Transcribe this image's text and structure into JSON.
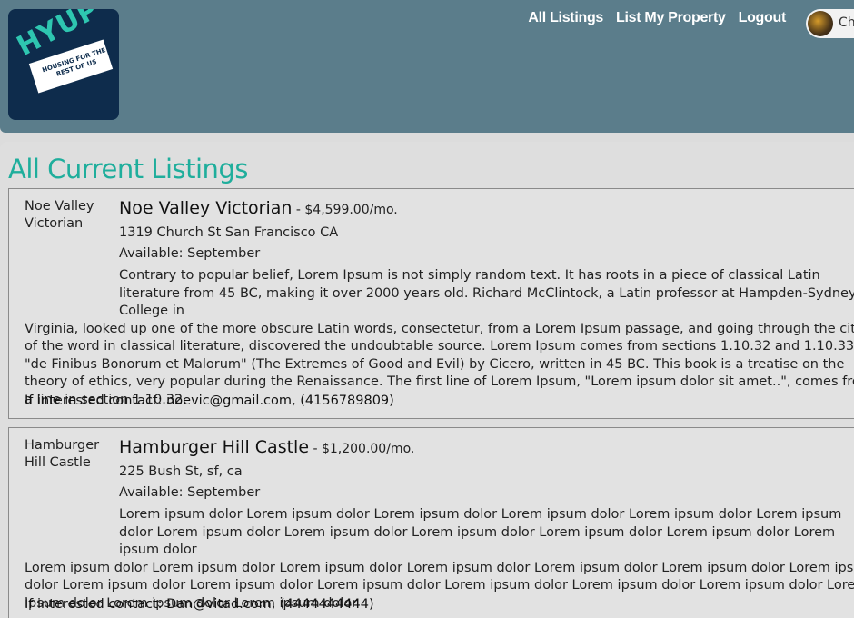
{
  "logo": {
    "big": "HYUP",
    "small": "HOUSING FOR THE REST OF US"
  },
  "nav": {
    "all_listings": "All Listings",
    "list_property": "List My Property",
    "logout": "Logout"
  },
  "user": {
    "name_partial": "Ch"
  },
  "page": {
    "title": "All Current Listings"
  },
  "listings": [
    {
      "side_label": "Noe Valley Victorian",
      "title": "Noe Valley Victorian",
      "price": " - $4,599.00/mo.",
      "address": "1319 Church St San Francisco CA",
      "available": "Available: September",
      "description_first": "Contrary to popular belief, Lorem Ipsum is not simply random text. It has roots in a piece of classical Latin literature from 45 BC, making it over 2000 years old. Richard McClintock, a Latin professor at Hampden-Sydney College in",
      "description_rest": "Virginia, looked up one of the more obscure Latin words, consectetur, from a Lorem Ipsum passage, and going through the cites of the word in classical literature, discovered the undoubtable source. Lorem Ipsum comes from sections 1.10.32 and 1.10.33 of \"de Finibus Bonorum et Malorum\" (The Extremes of Good and Evil) by Cicero, written in 45 BC. This book is a treatise on the theory of ethics, very popular during the Renaissance. The first line of Lorem Ipsum, \"Lorem ipsum dolor sit amet..\", comes from a line in section 1.10.32.",
      "contact": "If interested contact: noevic@gmail.com, (4156789809)"
    },
    {
      "side_label": "Hamburger Hill Castle",
      "title": "Hamburger Hill Castle",
      "price": " - $1,200.00/mo.",
      "address": "225 Bush St, sf, ca",
      "available": "Available: September",
      "description_first": "Lorem ipsum dolor Lorem ipsum dolor Lorem ipsum dolor Lorem ipsum dolor Lorem ipsum dolor Lorem ipsum dolor Lorem ipsum dolor Lorem ipsum dolor Lorem ipsum dolor Lorem ipsum dolor Lorem ipsum dolor Lorem ipsum dolor",
      "description_rest": "Lorem ipsum dolor Lorem ipsum dolor Lorem ipsum dolor Lorem ipsum dolor Lorem ipsum dolor Lorem ipsum dolor Lorem ipsum dolor Lorem ipsum dolor Lorem ipsum dolor Lorem ipsum dolor Lorem ipsum dolor Lorem ipsum dolor Lorem ipsum dolor Lorem ipsum dolor Lorem ipsum dolor Lorem ipsum dolor",
      "contact": "If interested contact: Dan@vitad.com, (4444444444)"
    }
  ]
}
